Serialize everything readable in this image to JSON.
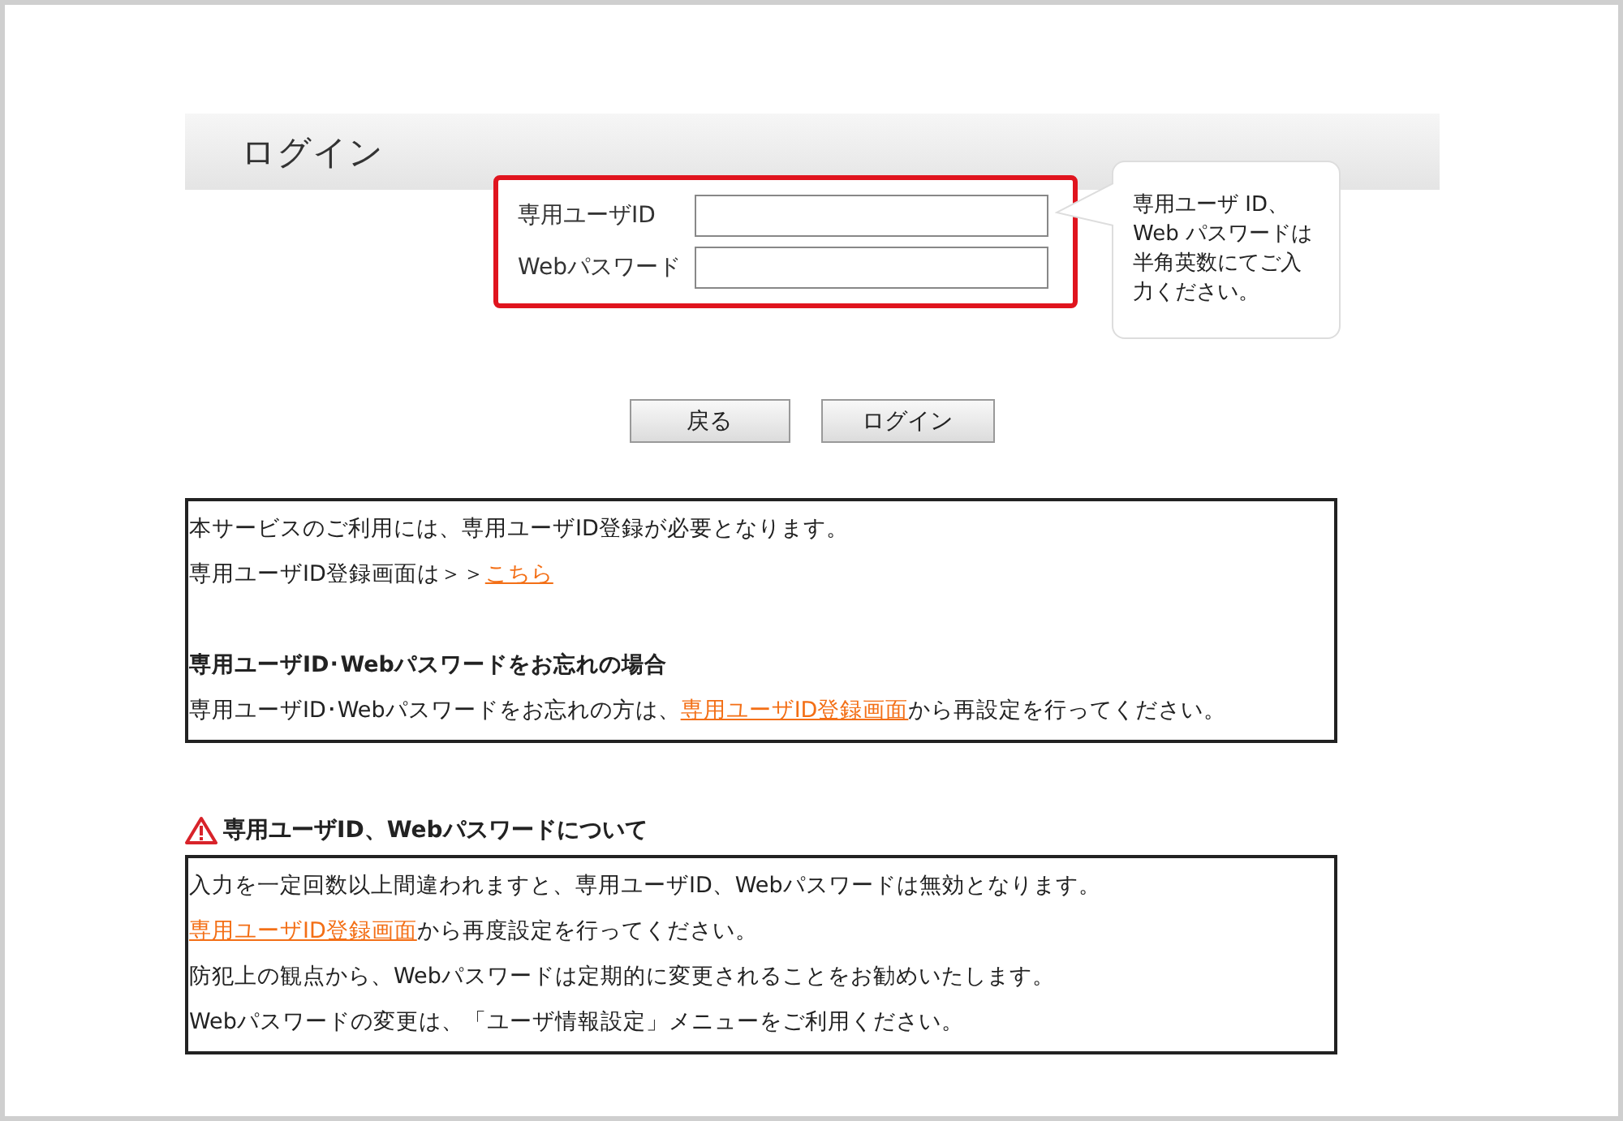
{
  "header": {
    "title": "ログイン"
  },
  "form": {
    "fields": [
      {
        "label": "専用ユーザID"
      },
      {
        "label": "Webパスワード"
      }
    ],
    "tooltip": "専用ユーザ ID、Web パスワードは半角英数にてご入力ください。"
  },
  "buttons": [
    "戻る",
    "ログイン"
  ],
  "info_box": {
    "lines": [
      {
        "kind": "text",
        "parts": [
          {
            "text": "本サービスのご利用には、専用ユーザID登録が必要となります。",
            "link": false
          }
        ]
      },
      {
        "kind": "text",
        "parts": [
          {
            "text": "専用ユーザID登録画面は＞＞",
            "link": false
          },
          {
            "text": "こちら",
            "link": true
          }
        ]
      },
      {
        "kind": "blank"
      },
      {
        "kind": "heading",
        "text": "専用ユーザID･Webパスワードをお忘れの場合"
      },
      {
        "kind": "text",
        "parts": [
          {
            "text": "専用ユーザID･Webパスワードをお忘れの方は、",
            "link": false
          },
          {
            "text": "専用ユーザID登録画面",
            "link": true
          },
          {
            "text": "から再設定を行ってください。",
            "link": false
          }
        ]
      }
    ]
  },
  "notice": {
    "heading": "専用ユーザID、Webパスワードについて",
    "lines": [
      {
        "kind": "text",
        "parts": [
          {
            "text": "入力を一定回数以上間違われますと、専用ユーザID、Webパスワードは無効となります。",
            "link": false
          }
        ]
      },
      {
        "kind": "text",
        "parts": [
          {
            "text": "専用ユーザID登録画面",
            "link": true
          },
          {
            "text": "から再度設定を行ってください。",
            "link": false
          }
        ]
      },
      {
        "kind": "text",
        "parts": [
          {
            "text": "防犯上の観点から、Webパスワードは定期的に変更されることをお勧めいたします。",
            "link": false
          }
        ]
      },
      {
        "kind": "text",
        "parts": [
          {
            "text": "Webパスワードの変更は、「ユーザ情報設定」メニューをご利用ください。",
            "link": false
          }
        ]
      }
    ]
  }
}
